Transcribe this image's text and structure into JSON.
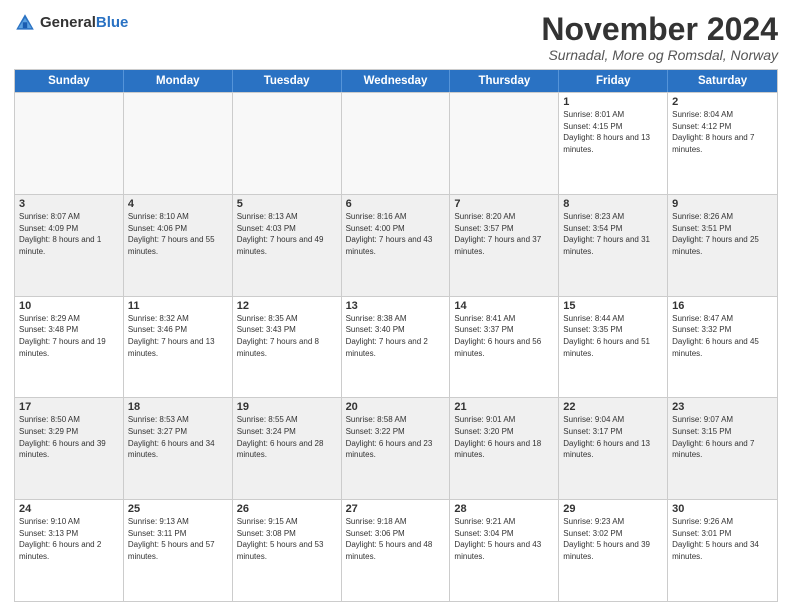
{
  "logo": {
    "general": "General",
    "blue": "Blue"
  },
  "header": {
    "title": "November 2024",
    "subtitle": "Surnadal, More og Romsdal, Norway"
  },
  "weekdays": [
    "Sunday",
    "Monday",
    "Tuesday",
    "Wednesday",
    "Thursday",
    "Friday",
    "Saturday"
  ],
  "rows": [
    [
      {
        "day": "",
        "empty": true
      },
      {
        "day": "",
        "empty": true
      },
      {
        "day": "",
        "empty": true
      },
      {
        "day": "",
        "empty": true
      },
      {
        "day": "",
        "empty": true
      },
      {
        "day": "1",
        "sunrise": "Sunrise: 8:01 AM",
        "sunset": "Sunset: 4:15 PM",
        "daylight": "Daylight: 8 hours and 13 minutes."
      },
      {
        "day": "2",
        "sunrise": "Sunrise: 8:04 AM",
        "sunset": "Sunset: 4:12 PM",
        "daylight": "Daylight: 8 hours and 7 minutes."
      }
    ],
    [
      {
        "day": "3",
        "sunrise": "Sunrise: 8:07 AM",
        "sunset": "Sunset: 4:09 PM",
        "daylight": "Daylight: 8 hours and 1 minute."
      },
      {
        "day": "4",
        "sunrise": "Sunrise: 8:10 AM",
        "sunset": "Sunset: 4:06 PM",
        "daylight": "Daylight: 7 hours and 55 minutes."
      },
      {
        "day": "5",
        "sunrise": "Sunrise: 8:13 AM",
        "sunset": "Sunset: 4:03 PM",
        "daylight": "Daylight: 7 hours and 49 minutes."
      },
      {
        "day": "6",
        "sunrise": "Sunrise: 8:16 AM",
        "sunset": "Sunset: 4:00 PM",
        "daylight": "Daylight: 7 hours and 43 minutes."
      },
      {
        "day": "7",
        "sunrise": "Sunrise: 8:20 AM",
        "sunset": "Sunset: 3:57 PM",
        "daylight": "Daylight: 7 hours and 37 minutes."
      },
      {
        "day": "8",
        "sunrise": "Sunrise: 8:23 AM",
        "sunset": "Sunset: 3:54 PM",
        "daylight": "Daylight: 7 hours and 31 minutes."
      },
      {
        "day": "9",
        "sunrise": "Sunrise: 8:26 AM",
        "sunset": "Sunset: 3:51 PM",
        "daylight": "Daylight: 7 hours and 25 minutes."
      }
    ],
    [
      {
        "day": "10",
        "sunrise": "Sunrise: 8:29 AM",
        "sunset": "Sunset: 3:48 PM",
        "daylight": "Daylight: 7 hours and 19 minutes."
      },
      {
        "day": "11",
        "sunrise": "Sunrise: 8:32 AM",
        "sunset": "Sunset: 3:46 PM",
        "daylight": "Daylight: 7 hours and 13 minutes."
      },
      {
        "day": "12",
        "sunrise": "Sunrise: 8:35 AM",
        "sunset": "Sunset: 3:43 PM",
        "daylight": "Daylight: 7 hours and 8 minutes."
      },
      {
        "day": "13",
        "sunrise": "Sunrise: 8:38 AM",
        "sunset": "Sunset: 3:40 PM",
        "daylight": "Daylight: 7 hours and 2 minutes."
      },
      {
        "day": "14",
        "sunrise": "Sunrise: 8:41 AM",
        "sunset": "Sunset: 3:37 PM",
        "daylight": "Daylight: 6 hours and 56 minutes."
      },
      {
        "day": "15",
        "sunrise": "Sunrise: 8:44 AM",
        "sunset": "Sunset: 3:35 PM",
        "daylight": "Daylight: 6 hours and 51 minutes."
      },
      {
        "day": "16",
        "sunrise": "Sunrise: 8:47 AM",
        "sunset": "Sunset: 3:32 PM",
        "daylight": "Daylight: 6 hours and 45 minutes."
      }
    ],
    [
      {
        "day": "17",
        "sunrise": "Sunrise: 8:50 AM",
        "sunset": "Sunset: 3:29 PM",
        "daylight": "Daylight: 6 hours and 39 minutes."
      },
      {
        "day": "18",
        "sunrise": "Sunrise: 8:53 AM",
        "sunset": "Sunset: 3:27 PM",
        "daylight": "Daylight: 6 hours and 34 minutes."
      },
      {
        "day": "19",
        "sunrise": "Sunrise: 8:55 AM",
        "sunset": "Sunset: 3:24 PM",
        "daylight": "Daylight: 6 hours and 28 minutes."
      },
      {
        "day": "20",
        "sunrise": "Sunrise: 8:58 AM",
        "sunset": "Sunset: 3:22 PM",
        "daylight": "Daylight: 6 hours and 23 minutes."
      },
      {
        "day": "21",
        "sunrise": "Sunrise: 9:01 AM",
        "sunset": "Sunset: 3:20 PM",
        "daylight": "Daylight: 6 hours and 18 minutes."
      },
      {
        "day": "22",
        "sunrise": "Sunrise: 9:04 AM",
        "sunset": "Sunset: 3:17 PM",
        "daylight": "Daylight: 6 hours and 13 minutes."
      },
      {
        "day": "23",
        "sunrise": "Sunrise: 9:07 AM",
        "sunset": "Sunset: 3:15 PM",
        "daylight": "Daylight: 6 hours and 7 minutes."
      }
    ],
    [
      {
        "day": "24",
        "sunrise": "Sunrise: 9:10 AM",
        "sunset": "Sunset: 3:13 PM",
        "daylight": "Daylight: 6 hours and 2 minutes."
      },
      {
        "day": "25",
        "sunrise": "Sunrise: 9:13 AM",
        "sunset": "Sunset: 3:11 PM",
        "daylight": "Daylight: 5 hours and 57 minutes."
      },
      {
        "day": "26",
        "sunrise": "Sunrise: 9:15 AM",
        "sunset": "Sunset: 3:08 PM",
        "daylight": "Daylight: 5 hours and 53 minutes."
      },
      {
        "day": "27",
        "sunrise": "Sunrise: 9:18 AM",
        "sunset": "Sunset: 3:06 PM",
        "daylight": "Daylight: 5 hours and 48 minutes."
      },
      {
        "day": "28",
        "sunrise": "Sunrise: 9:21 AM",
        "sunset": "Sunset: 3:04 PM",
        "daylight": "Daylight: 5 hours and 43 minutes."
      },
      {
        "day": "29",
        "sunrise": "Sunrise: 9:23 AM",
        "sunset": "Sunset: 3:02 PM",
        "daylight": "Daylight: 5 hours and 39 minutes."
      },
      {
        "day": "30",
        "sunrise": "Sunrise: 9:26 AM",
        "sunset": "Sunset: 3:01 PM",
        "daylight": "Daylight: 5 hours and 34 minutes."
      }
    ]
  ]
}
